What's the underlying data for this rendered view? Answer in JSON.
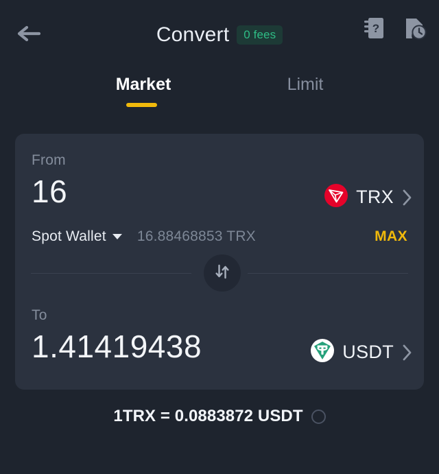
{
  "header": {
    "back_icon": "arrow-left-icon",
    "title": "Convert",
    "fees_badge": "0 fees",
    "faq_icon": "faq-book-icon",
    "history_icon": "document-clock-icon"
  },
  "tabs": [
    {
      "id": "market",
      "label": "Market",
      "active": true
    },
    {
      "id": "limit",
      "label": "Limit",
      "active": false
    }
  ],
  "convert": {
    "from": {
      "label": "From",
      "amount": "16",
      "token_symbol": "TRX",
      "token_icon": "trx-coin-icon",
      "chevron_icon": "chevron-right-icon",
      "wallet": "Spot Wallet",
      "wallet_caret_icon": "caret-down-icon",
      "balance": "16.88468853 TRX",
      "max_label": "MAX"
    },
    "swap_icon": "swap-vertical-icon",
    "to": {
      "label": "To",
      "amount": "1.41419438",
      "token_symbol": "USDT",
      "token_icon": "usdt-coin-icon",
      "chevron_icon": "chevron-right-icon"
    }
  },
  "rate": {
    "text": "1TRX = 0.0883872 USDT",
    "spinner_icon": "refresh-circle-icon"
  },
  "colors": {
    "background": "#1e242e",
    "card": "#2b323f",
    "accent_yellow": "#f0b90b",
    "fees_green": "#2ebd85",
    "trx_red": "#e5032a",
    "usdt_green": "#26a17b",
    "muted_text": "#848d9c"
  }
}
